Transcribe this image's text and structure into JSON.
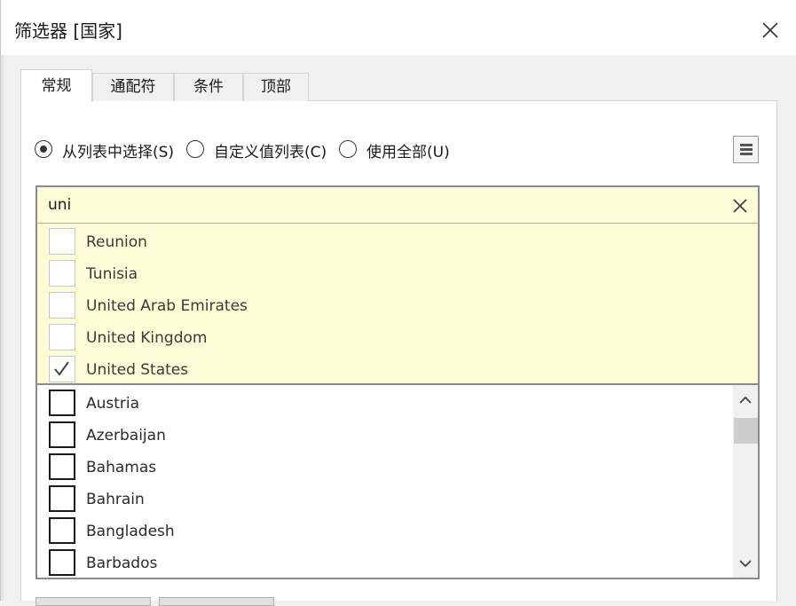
{
  "window": {
    "title": "筛选器 [国家]"
  },
  "tabs": [
    {
      "label": "常规",
      "active": true
    },
    {
      "label": "通配符",
      "active": false
    },
    {
      "label": "条件",
      "active": false
    },
    {
      "label": "顶部",
      "active": false
    }
  ],
  "mode_options": [
    {
      "label": "从列表中选择(S)",
      "selected": true
    },
    {
      "label": "自定义值列表(C)",
      "selected": false
    },
    {
      "label": "使用全部(U)",
      "selected": false
    }
  ],
  "search": {
    "value": "uni"
  },
  "matches": [
    {
      "label": "Reunion",
      "checked": false
    },
    {
      "label": "Tunisia",
      "checked": false
    },
    {
      "label": "United Arab Emirates",
      "checked": false
    },
    {
      "label": "United Kingdom",
      "checked": false
    },
    {
      "label": "United States",
      "checked": true
    }
  ],
  "list": [
    {
      "label": "Austria",
      "checked": false
    },
    {
      "label": "Azerbaijan",
      "checked": false
    },
    {
      "label": "Bahamas",
      "checked": false
    },
    {
      "label": "Bahrain",
      "checked": false
    },
    {
      "label": "Bangladesh",
      "checked": false
    },
    {
      "label": "Barbados",
      "checked": false
    }
  ],
  "icons": {
    "close": "close-icon",
    "menu": "menu-icon",
    "clear": "clear-search-icon",
    "check": "checkmark-icon",
    "scroll_up": "chevron-up-icon",
    "scroll_down": "chevron-down-icon"
  },
  "colors": {
    "match_highlight": "#fdfdd8",
    "border": "#8a8a8a",
    "dialog_bg": "#f0f0f0"
  }
}
